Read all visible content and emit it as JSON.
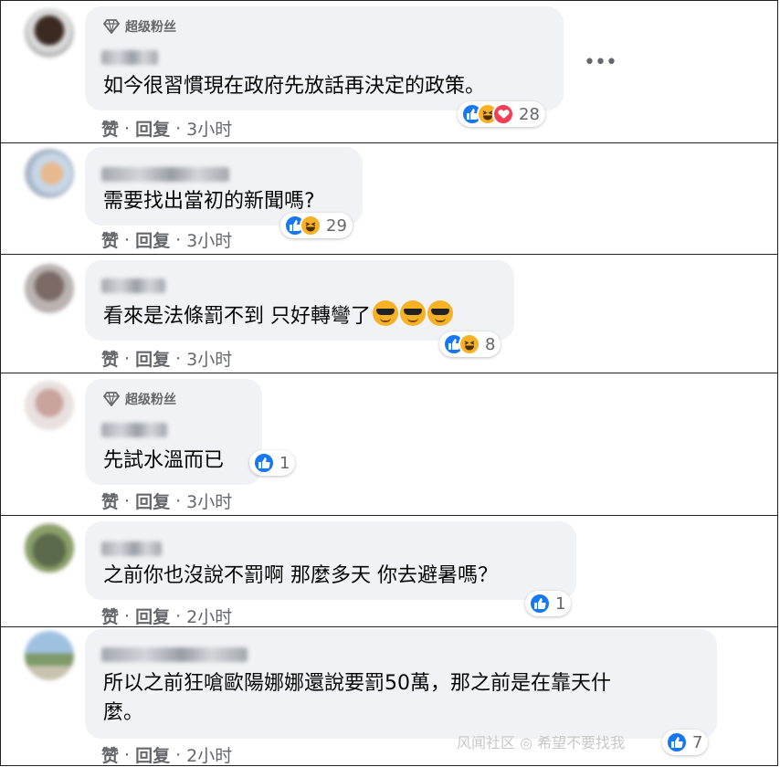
{
  "comments": [
    {
      "badge": "超级粉丝",
      "text": "如今很習慣現在政府先放話再決定的政策。",
      "reactions": [
        "like",
        "haha",
        "love"
      ],
      "count": "28",
      "like": "赞",
      "reply": "回复",
      "time": "3小时"
    },
    {
      "badge": "",
      "text": "需要找出當初的新聞嗎?",
      "reactions": [
        "like",
        "haha"
      ],
      "count": "29",
      "like": "赞",
      "reply": "回复",
      "time": "3小时"
    },
    {
      "badge": "",
      "text": "看來是法條罰不到 只好轉彎了",
      "reactions": [
        "like",
        "haha"
      ],
      "count": "8",
      "like": "赞",
      "reply": "回复",
      "time": "3小时"
    },
    {
      "badge": "超级粉丝",
      "text": "先試水溫而已",
      "reactions": [
        "like"
      ],
      "count": "1",
      "like": "赞",
      "reply": "回复",
      "time": "3小时"
    },
    {
      "badge": "",
      "text": "之前你也沒說不罰啊 那麼多天 你去避暑嗎？",
      "reactions": [
        "like"
      ],
      "count": "1",
      "like": "赞",
      "reply": "回复",
      "time": "2小时"
    },
    {
      "badge": "",
      "text": "所以之前狂嗆歐陽娜娜還說要罰50萬，那之前是在靠天什\n麼。",
      "reactions": [
        "like"
      ],
      "count": "7",
      "like": "赞",
      "reply": "回复",
      "time": "2小时"
    }
  ],
  "separator": "·",
  "more_icon": "more-horizontal-icon",
  "watermark": "风闻社区 ◎ 希望不要找我"
}
